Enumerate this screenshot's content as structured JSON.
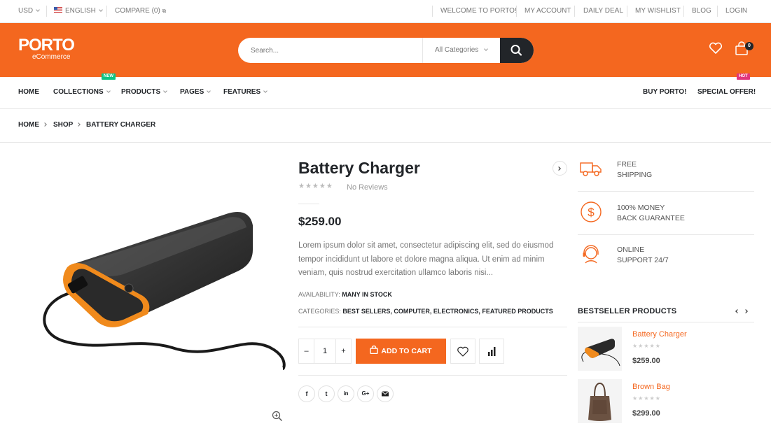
{
  "topbar": {
    "currency": "USD",
    "language": "ENGLISH",
    "compare": "COMPARE (0)",
    "links": [
      "WELCOME TO PORTO!",
      "MY ACCOUNT",
      "DAILY DEAL",
      "MY WISHLIST",
      "BLOG",
      "LOGIN"
    ]
  },
  "header": {
    "logo_main": "PORTO",
    "logo_sub": "eCommerce",
    "search_placeholder": "Search...",
    "category_select": "All Categories",
    "cart_count": "0",
    "icons": [
      "heart-icon",
      "cart-icon",
      "search-icon"
    ]
  },
  "nav": {
    "items": [
      "HOME",
      "COLLECTIONS",
      "PRODUCTS",
      "PAGES",
      "FEATURES"
    ],
    "collections_tag": "NEW",
    "right_items": [
      "BUY PORTO!",
      "SPECIAL OFFER!"
    ],
    "special_tag": "HOT"
  },
  "breadcrumb": [
    "HOME",
    "SHOP",
    "BATTERY CHARGER"
  ],
  "product": {
    "title": "Battery Charger",
    "rating": 0,
    "reviews": "No Reviews",
    "price": "$259.00",
    "description": "Lorem ipsum dolor sit amet, consectetur adipiscing elit, sed do eiusmod tempor incididunt ut labore et dolore magna aliqua. Ut enim ad minim veniam, quis nostrud exercitation ullamco laboris nisi...",
    "availability_label": "AVAILABILITY:",
    "availability_value": "MANY IN STOCK",
    "categories_label": "CATEGORIES:",
    "categories_value": "BEST SELLERS, COMPUTER, ELECTRONICS, FEATURED PRODUCTS",
    "quantity": "1",
    "add_to_cart": "ADD TO CART",
    "social": [
      "f",
      "t",
      "in",
      "G+",
      "mail"
    ]
  },
  "features": [
    {
      "line1": "FREE",
      "line2": "SHIPPING",
      "icon": "truck-icon"
    },
    {
      "line1": "100% MONEY",
      "line2": "BACK GUARANTEE",
      "icon": "dollar-icon"
    },
    {
      "line1": "ONLINE",
      "line2": "SUPPORT 24/7",
      "icon": "support-icon"
    }
  ],
  "bestsellers": {
    "title": "BESTSELLER PRODUCTS",
    "items": [
      {
        "name": "Battery Charger",
        "price": "$259.00"
      },
      {
        "name": "Brown Bag",
        "price": "$299.00"
      }
    ]
  },
  "colors": {
    "accent": "#f4671f",
    "dark": "#222529",
    "new_tag": "#0cc485",
    "hot_tag": "#e2357c"
  }
}
